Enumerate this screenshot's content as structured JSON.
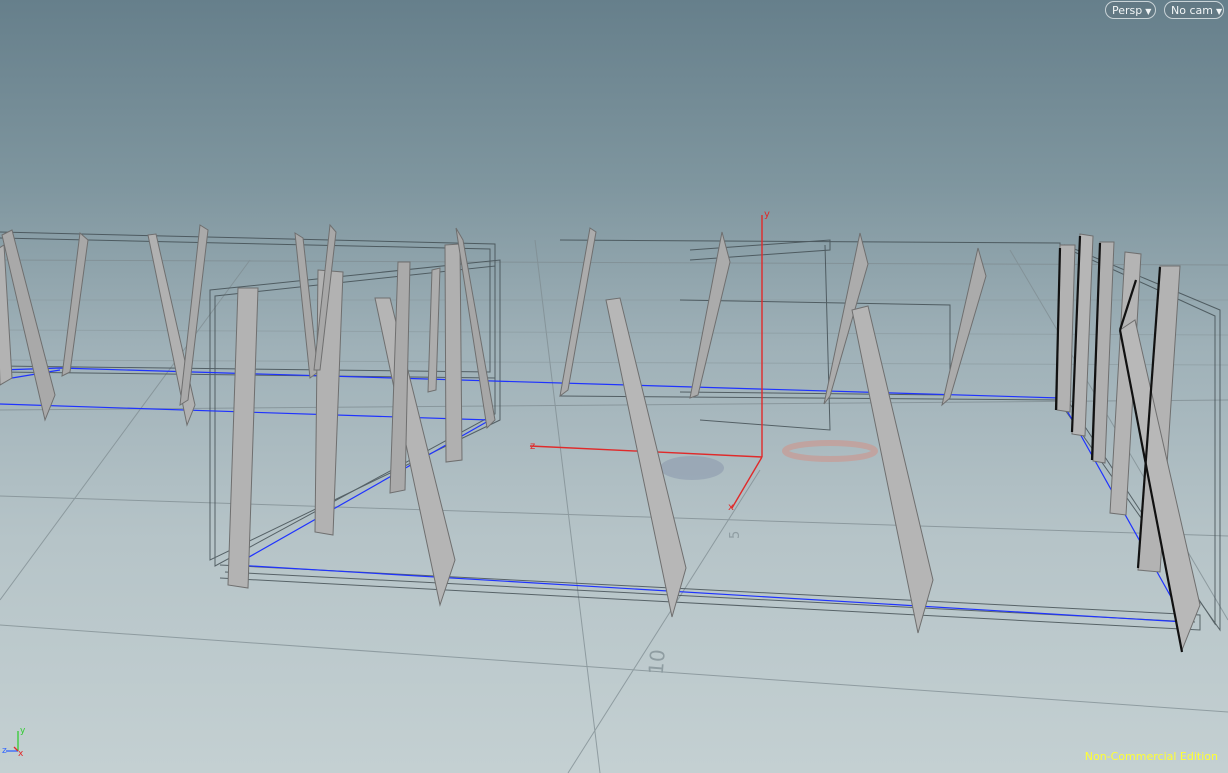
{
  "viewport": {
    "camera_menu": {
      "label": "Persp"
    },
    "camera_select": {
      "label": "No cam"
    },
    "watermark": "Non-Commercial Edition",
    "axis_labels": {
      "x": "x",
      "y": "y",
      "z": "z"
    },
    "grid_numbers": [
      "5",
      "10"
    ],
    "colors": {
      "x_axis": "#e02a2a",
      "y_axis": "#e02a2a",
      "z_axis": "#e02a2a",
      "guide_line": "#1f33ff",
      "watermark": "#ffff33",
      "panel": "#b1b1b1"
    }
  }
}
